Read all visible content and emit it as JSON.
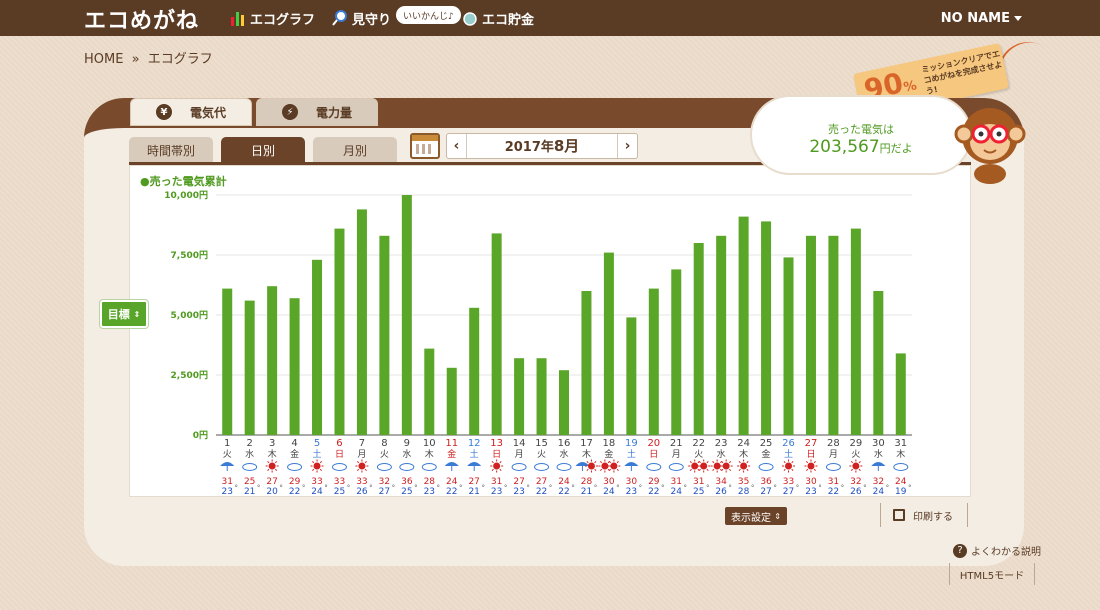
{
  "header": {
    "logo": "エコめがね",
    "nav": [
      {
        "label": "エコグラフ",
        "icon": "bar-chart-icon"
      },
      {
        "label": "見守り",
        "icon": "magnifier-icon"
      },
      {
        "label": "エコ貯金",
        "icon": "piggy-bank-icon"
      }
    ],
    "bubble": "いいかんじ♪",
    "user": "NO NAME"
  },
  "breadcrumb": {
    "home": "HOME",
    "sep": "»",
    "current": "エコグラフ"
  },
  "mission": {
    "percent": "90",
    "percent_sign": "%",
    "message": "ミッションクリアでエコめがねを完成させよう!"
  },
  "tabs": [
    {
      "label": "電気代",
      "icon": "¥",
      "active": true
    },
    {
      "label": "電力量",
      "icon": "⚡",
      "active": false
    }
  ],
  "subtabs": [
    {
      "label": "時間帯別",
      "active": false
    },
    {
      "label": "日別",
      "active": true
    },
    {
      "label": "月別",
      "active": false
    }
  ],
  "date": {
    "year": "2017年",
    "month": "8月",
    "prev": "‹",
    "next": "›"
  },
  "summary": {
    "label": "売った電気は",
    "amount": "203,567",
    "suffix": "円だよ"
  },
  "chart_legend": "●売った電気累計",
  "target_label": "目標",
  "display_settings": "表示設定",
  "print": "印刷する",
  "help": "よくわかる説明",
  "html5": "HTML5モード",
  "colors": {
    "bar": "#5aa628",
    "brown": "#5a3b24",
    "sat": "#3a7bd5",
    "sun": "#d02020"
  },
  "chart_data": {
    "type": "bar",
    "ylim": [
      0,
      10000
    ],
    "yticks": [
      "0円",
      "2,500円",
      "5,000円",
      "7,500円",
      "10,000円"
    ],
    "yvalues": [
      0,
      2500,
      5000,
      7500,
      10000
    ],
    "series": [
      {
        "values": [
          6100,
          5600,
          6200,
          5700,
          7300,
          8600,
          9400,
          8300,
          10000,
          3600,
          2800,
          5300,
          8400,
          3200,
          3200,
          2700,
          6000,
          7600,
          4900,
          6100,
          6900,
          8000,
          8300,
          9100,
          8900,
          7400,
          8300,
          8300,
          8600,
          6000,
          3400
        ]
      }
    ],
    "days": [
      "1",
      "2",
      "3",
      "4",
      "5",
      "6",
      "7",
      "8",
      "9",
      "10",
      "11",
      "12",
      "13",
      "14",
      "15",
      "16",
      "17",
      "18",
      "19",
      "20",
      "21",
      "22",
      "23",
      "24",
      "25",
      "26",
      "27",
      "28",
      "29",
      "30",
      "31"
    ],
    "weekdays": [
      "火",
      "水",
      "木",
      "金",
      "土",
      "日",
      "月",
      "火",
      "水",
      "木",
      "金",
      "土",
      "日",
      "月",
      "火",
      "水",
      "木",
      "金",
      "土",
      "日",
      "月",
      "火",
      "水",
      "木",
      "金",
      "土",
      "日",
      "月",
      "火",
      "水",
      "木"
    ],
    "day_colors": [
      "n",
      "n",
      "n",
      "n",
      "sat",
      "sun",
      "n",
      "n",
      "n",
      "n",
      "sun",
      "sat",
      "sun",
      "n",
      "n",
      "n",
      "n",
      "n",
      "sat",
      "sun",
      "n",
      "n",
      "n",
      "n",
      "n",
      "sat",
      "sun",
      "n",
      "n",
      "n",
      "n"
    ],
    "weather": [
      "rain",
      "cloud",
      "sun",
      "cloud",
      "sun",
      "cloud",
      "sun",
      "cloud",
      "cloud",
      "cloud",
      "rain",
      "rain",
      "sun",
      "cloud",
      "cloud",
      "cloud",
      "sunrain",
      "sunsun",
      "rain",
      "cloud",
      "cloud",
      "sunsun",
      "sunsun",
      "sun",
      "cloud",
      "sun",
      "sun",
      "cloud",
      "sun",
      "rain",
      "cloud"
    ],
    "temp_high": [
      "31",
      "25",
      "27",
      "29",
      "33",
      "33",
      "33",
      "32",
      "36",
      "28",
      "24",
      "27",
      "31",
      "27",
      "27",
      "24",
      "28",
      "30",
      "30",
      "29",
      "31",
      "31",
      "34",
      "35",
      "36",
      "33",
      "30",
      "31",
      "32",
      "32",
      "24"
    ],
    "temp_low": [
      "23",
      "21",
      "20",
      "22",
      "24",
      "25",
      "26",
      "27",
      "25",
      "23",
      "22",
      "21",
      "23",
      "23",
      "22",
      "22",
      "21",
      "24",
      "23",
      "22",
      "24",
      "25",
      "26",
      "28",
      "27",
      "27",
      "23",
      "22",
      "26",
      "24",
      "19"
    ],
    "degree_mark": "°"
  }
}
